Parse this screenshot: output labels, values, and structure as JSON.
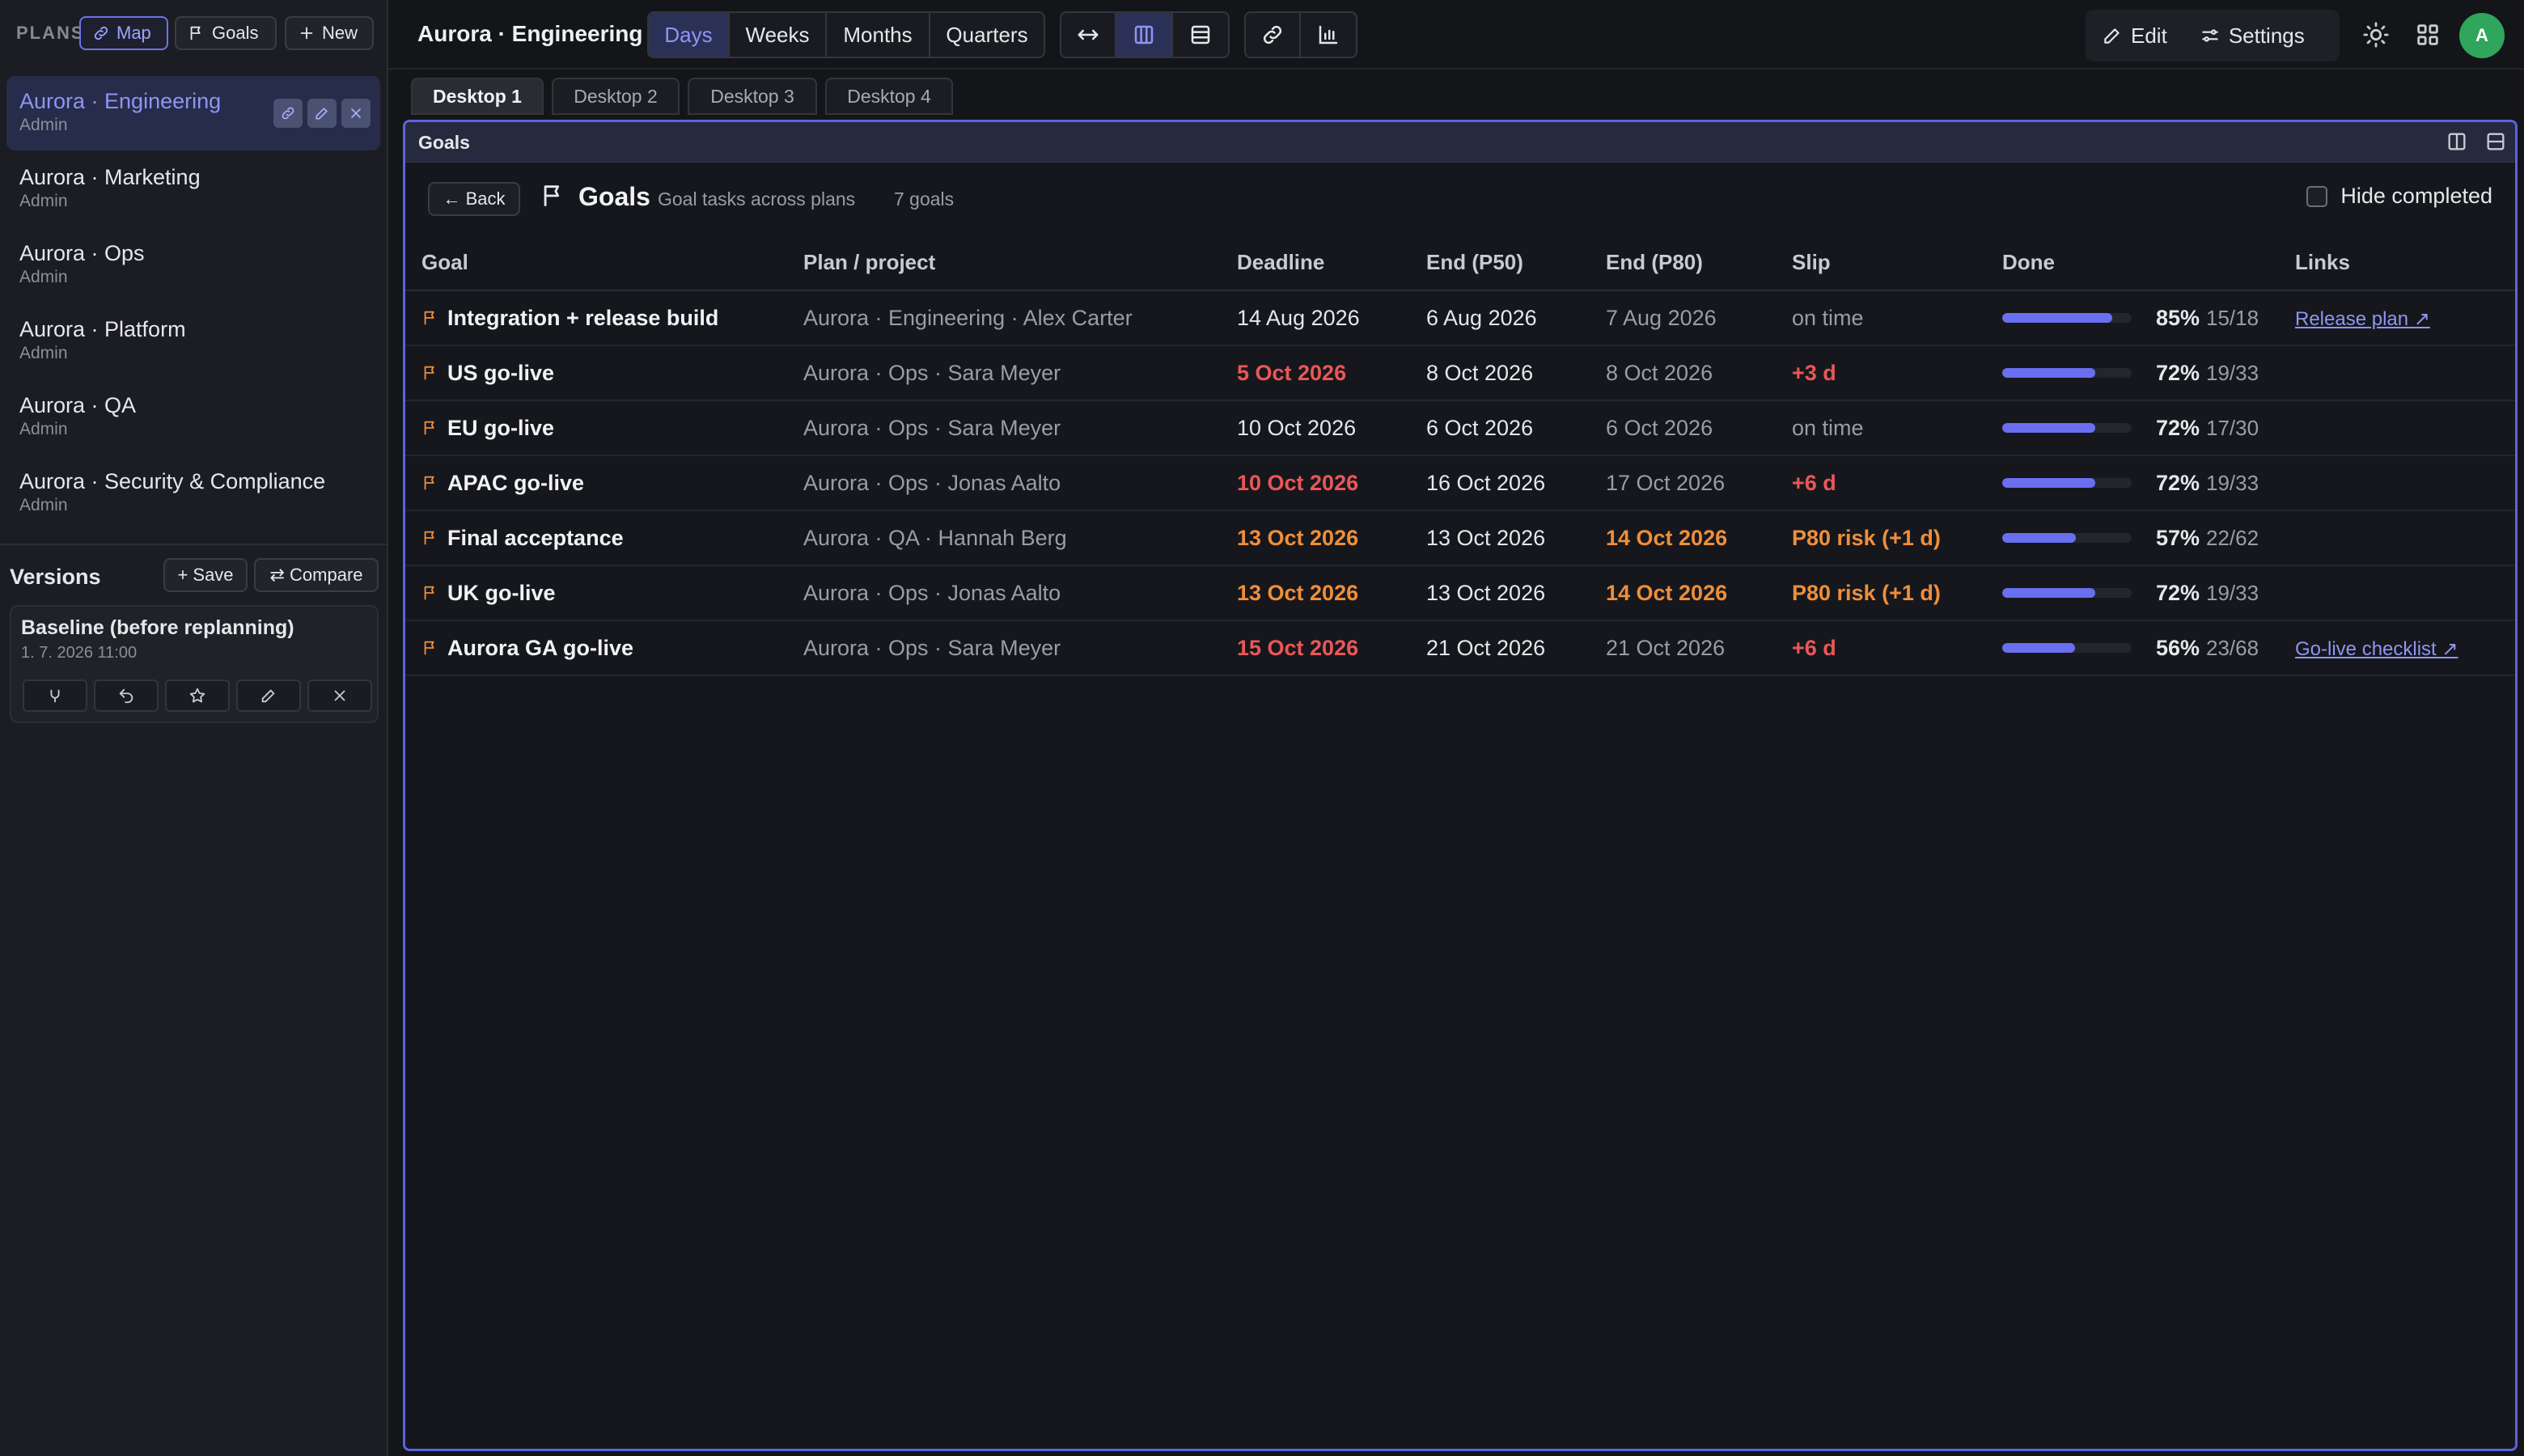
{
  "sidebar": {
    "plans_label": "PLANS",
    "map_label": "Map",
    "goals_label": "Goals",
    "new_label": "New",
    "plans": [
      {
        "name": "Aurora · Engineering",
        "role": "Admin",
        "active": true
      },
      {
        "name": "Aurora · Marketing",
        "role": "Admin",
        "active": false
      },
      {
        "name": "Aurora · Ops",
        "role": "Admin",
        "active": false
      },
      {
        "name": "Aurora · Platform",
        "role": "Admin",
        "active": false
      },
      {
        "name": "Aurora · QA",
        "role": "Admin",
        "active": false
      },
      {
        "name": "Aurora · Security & Compliance",
        "role": "Admin",
        "active": false
      }
    ],
    "versions": {
      "title": "Versions",
      "save_label": "+ Save",
      "compare_label": "⇄ Compare",
      "items": [
        {
          "name": "Baseline (before replanning)",
          "date": "1. 7. 2026 11:00"
        }
      ]
    }
  },
  "topbar": {
    "title": "Aurora · Engineering",
    "zoom_options": [
      "Days",
      "Weeks",
      "Months",
      "Quarters"
    ],
    "zoom_selected": "Days",
    "edit_label": "Edit",
    "settings_label": "Settings",
    "avatar_initial": "A"
  },
  "desktop_tabs": [
    "Desktop 1",
    "Desktop 2",
    "Desktop 3",
    "Desktop 4"
  ],
  "active_desktop": "Desktop 1",
  "panel": {
    "title": "Goals",
    "back_label": "← Back",
    "heading": "Goals",
    "subtitle": "Goal tasks across plans",
    "count": "7 goals",
    "hide_completed_label": "Hide completed",
    "hide_completed_checked": false,
    "columns": [
      "Goal",
      "Plan / project",
      "Deadline",
      "End (P50)",
      "End (P80)",
      "Slip",
      "Done",
      "Links"
    ],
    "rows": [
      {
        "goal": "Integration + release build",
        "plan": "Aurora · Engineering · Alex Carter",
        "deadline": "14 Aug 2026",
        "deadline_status": "normal",
        "p50": "6 Aug 2026",
        "p80": "7 Aug 2026",
        "p80_status": "muted",
        "slip": "on time",
        "slip_status": "ok",
        "done_pct": 85,
        "done_label": "85%",
        "done_frac": "15/18",
        "link": "Release plan ↗"
      },
      {
        "goal": "US go-live",
        "plan": "Aurora · Ops · Sara Meyer",
        "deadline": "5 Oct 2026",
        "deadline_status": "red",
        "p50": "8 Oct 2026",
        "p80": "8 Oct 2026",
        "p80_status": "muted",
        "slip": "+3 d",
        "slip_status": "red",
        "done_pct": 72,
        "done_label": "72%",
        "done_frac": "19/33",
        "link": ""
      },
      {
        "goal": "EU go-live",
        "plan": "Aurora · Ops · Sara Meyer",
        "deadline": "10 Oct 2026",
        "deadline_status": "normal",
        "p50": "6 Oct 2026",
        "p80": "6 Oct 2026",
        "p80_status": "muted",
        "slip": "on time",
        "slip_status": "ok",
        "done_pct": 72,
        "done_label": "72%",
        "done_frac": "17/30",
        "link": ""
      },
      {
        "goal": "APAC go-live",
        "plan": "Aurora · Ops · Jonas Aalto",
        "deadline": "10 Oct 2026",
        "deadline_status": "red",
        "p50": "16 Oct 2026",
        "p80": "17 Oct 2026",
        "p80_status": "muted",
        "slip": "+6 d",
        "slip_status": "red",
        "done_pct": 72,
        "done_label": "72%",
        "done_frac": "19/33",
        "link": ""
      },
      {
        "goal": "Final acceptance",
        "plan": "Aurora · QA · Hannah Berg",
        "deadline": "13 Oct 2026",
        "deadline_status": "orange",
        "p50": "13 Oct 2026",
        "p80": "14 Oct 2026",
        "p80_status": "orange",
        "slip": "P80 risk (+1 d)",
        "slip_status": "orange",
        "done_pct": 57,
        "done_label": "57%",
        "done_frac": "22/62",
        "link": ""
      },
      {
        "goal": "UK go-live",
        "plan": "Aurora · Ops · Jonas Aalto",
        "deadline": "13 Oct 2026",
        "deadline_status": "orange",
        "p50": "13 Oct 2026",
        "p80": "14 Oct 2026",
        "p80_status": "orange",
        "slip": "P80 risk (+1 d)",
        "slip_status": "orange",
        "done_pct": 72,
        "done_label": "72%",
        "done_frac": "19/33",
        "link": ""
      },
      {
        "goal": "Aurora GA go-live",
        "plan": "Aurora · Ops · Sara Meyer",
        "deadline": "15 Oct 2026",
        "deadline_status": "red",
        "p50": "21 Oct 2026",
        "p80": "21 Oct 2026",
        "p80_status": "muted",
        "slip": "+6 d",
        "slip_status": "red",
        "done_pct": 56,
        "done_label": "56%",
        "done_frac": "23/68",
        "link": "Go-live checklist ↗"
      }
    ]
  },
  "colors": {
    "accent": "#6a6ff0",
    "danger": "#ea5757",
    "warning": "#ee8f3a",
    "avatar": "#2fa65b"
  }
}
